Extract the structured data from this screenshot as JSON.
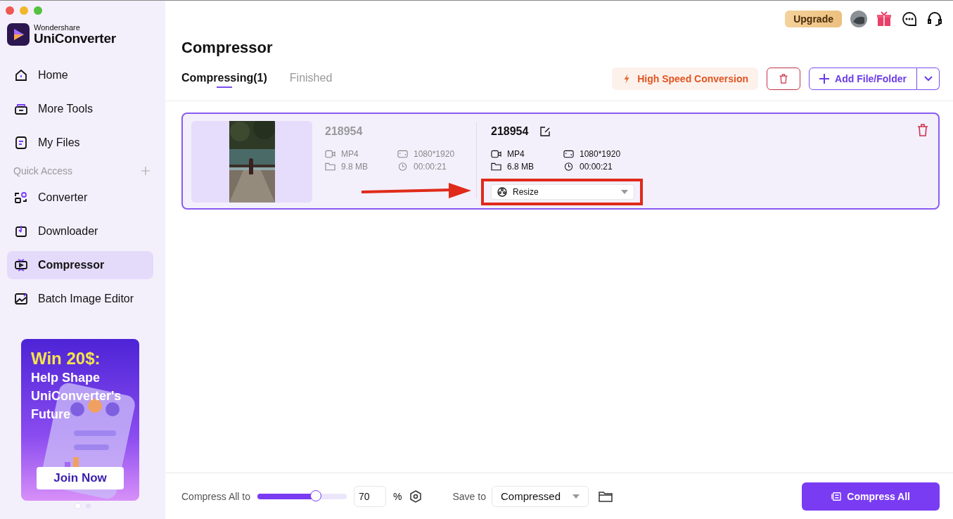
{
  "brand": {
    "maker": "Wondershare",
    "name": "UniConverter"
  },
  "sidebar": {
    "items": [
      {
        "label": "Home",
        "selected": false
      },
      {
        "label": "More Tools",
        "selected": false
      },
      {
        "label": "My Files",
        "selected": false
      }
    ],
    "quick_access": {
      "label": "Quick Access",
      "items": [
        {
          "label": "Converter",
          "selected": false
        },
        {
          "label": "Downloader",
          "selected": false
        },
        {
          "label": "Compressor",
          "selected": true
        },
        {
          "label": "Batch Image Editor",
          "selected": false
        }
      ]
    }
  },
  "promo": {
    "headline": "Win 20$:",
    "text": "Help Shape UniConverter's Future",
    "button": "Join Now",
    "pages": [
      {
        "selected": true
      },
      {
        "selected": false
      }
    ]
  },
  "header": {
    "upgrade": "Upgrade"
  },
  "title": "Compressor",
  "tabs": [
    {
      "label": "Compressing(1)",
      "selected": true
    },
    {
      "label": "Finished",
      "selected": false
    }
  ],
  "toolbar": {
    "high_speed": "High Speed Conversion",
    "add": "Add File/Folder"
  },
  "files": [
    {
      "source": {
        "name": "218954",
        "format": "MP4",
        "size": "9.8 MB",
        "resolution": "1080*1920",
        "duration": "00:00:21"
      },
      "output": {
        "name": "218954",
        "format": "MP4",
        "size": "6.8 MB",
        "resolution": "1080*1920",
        "duration": "00:00:21"
      },
      "method": "Resize"
    }
  ],
  "footer": {
    "compress_label": "Compress All to",
    "slider": {
      "level": 0.65
    },
    "value": "70",
    "unit": "%",
    "save_label": "Save to",
    "save_value": "Compressed",
    "button": "Compress All"
  }
}
